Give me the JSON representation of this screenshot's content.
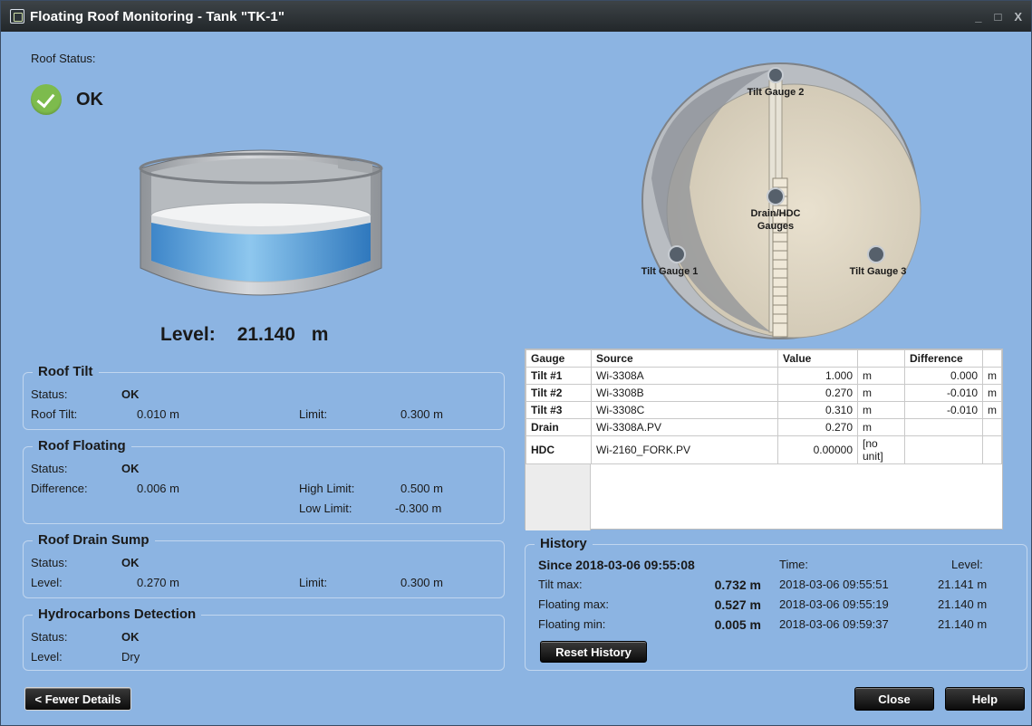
{
  "window": {
    "title": "Floating Roof Monitoring - Tank \"TK-1\"",
    "controls": [
      "_",
      "□",
      "X"
    ]
  },
  "roof_status": {
    "label": "Roof Status:",
    "value": "OK",
    "icon": "check-circle-icon",
    "icon_color": "#7dbb4d"
  },
  "level": {
    "label": "Level:",
    "value": "21.140",
    "unit": "m"
  },
  "roof_tilt": {
    "title": "Roof Tilt",
    "status_label": "Status:",
    "status_value": "OK",
    "tilt_label": "Roof Tilt:",
    "tilt_value": "0.010 m",
    "limit_label": "Limit:",
    "limit_value": "0.300 m"
  },
  "roof_floating": {
    "title": "Roof Floating",
    "status_label": "Status:",
    "status_value": "OK",
    "difference_label": "Difference:",
    "difference_value": "0.006 m",
    "high_limit_label": "High Limit:",
    "high_limit_value": "0.500 m",
    "low_limit_label": "Low Limit:",
    "low_limit_value": "-0.300 m"
  },
  "roof_drain_sump": {
    "title": "Roof Drain Sump",
    "status_label": "Status:",
    "status_value": "OK",
    "level_label": "Level:",
    "level_value": "0.270 m",
    "limit_label": "Limit:",
    "limit_value": "0.300 m"
  },
  "hydrocarbons": {
    "title": "Hydrocarbons Detection",
    "status_label": "Status:",
    "status_value": "OK",
    "level_label": "Level:",
    "level_value": "Dry"
  },
  "tank_top_labels": {
    "tilt2": "Tilt Gauge 2",
    "tilt1": "Tilt Gauge 1",
    "tilt3": "Tilt Gauge 3",
    "drain": "Drain/HDC",
    "gauges": "Gauges"
  },
  "gauge_table": {
    "headers": [
      "Gauge",
      "Source",
      "Value",
      "",
      "Difference",
      ""
    ],
    "rows": [
      {
        "gauge": "Tilt #1",
        "source": "Wi-3308A",
        "value": "1.000",
        "unit": "m",
        "diff": "0.000",
        "diff_unit": "m"
      },
      {
        "gauge": "Tilt #2",
        "source": "Wi-3308B",
        "value": "0.270",
        "unit": "m",
        "diff": "-0.010",
        "diff_unit": "m"
      },
      {
        "gauge": "Tilt #3",
        "source": "Wi-3308C",
        "value": "0.310",
        "unit": "m",
        "diff": "-0.010",
        "diff_unit": "m"
      },
      {
        "gauge": "Drain",
        "source": "Wi-3308A.PV",
        "value": "0.270",
        "unit": "m",
        "diff": "",
        "diff_unit": ""
      },
      {
        "gauge": "HDC",
        "source": "Wi-2160_FORK.PV",
        "value": "0.00000",
        "unit": "[no unit]",
        "diff": "",
        "diff_unit": ""
      }
    ]
  },
  "history": {
    "title": "History",
    "since": "Since 2018-03-06 09:55:08",
    "time_header": "Time:",
    "level_header": "Level:",
    "rows": [
      {
        "label": "Tilt max:",
        "value": "0.732 m",
        "time": "2018-03-06 09:55:51",
        "level": "21.141 m"
      },
      {
        "label": "Floating max:",
        "value": "0.527 m",
        "time": "2018-03-06 09:55:19",
        "level": "21.140 m"
      },
      {
        "label": "Floating min:",
        "value": "0.005 m",
        "time": "2018-03-06 09:59:37",
        "level": "21.140 m"
      }
    ],
    "reset_label": "Reset History"
  },
  "buttons": {
    "fewer_details": "< Fewer Details",
    "close": "Close",
    "help": "Help"
  }
}
